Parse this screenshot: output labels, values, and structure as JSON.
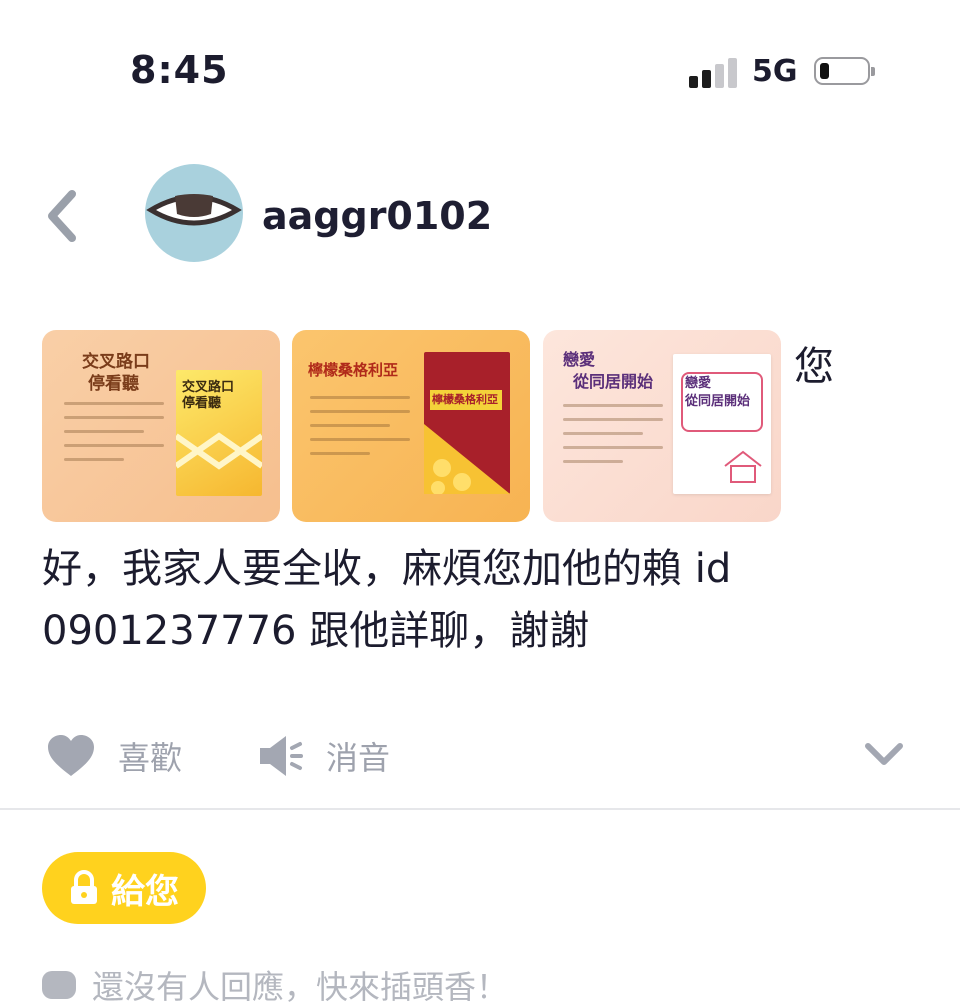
{
  "status_bar": {
    "time": "8:45",
    "network": "5G"
  },
  "header": {
    "username": "aaggr0102"
  },
  "post": {
    "images": [
      {
        "title_a": "交叉路口",
        "title_b": "停看聽",
        "cover_a": "交叉路口",
        "cover_b": "停看聽"
      },
      {
        "title_a": "檸檬桑格利亞",
        "title_b": "",
        "cover_a": "檸檬桑格利亞",
        "cover_b": ""
      },
      {
        "title_a": "戀愛",
        "title_b": "從同居開始",
        "cover_a": "戀愛",
        "cover_b": "從同居開始"
      }
    ],
    "text_first": "您",
    "text_rest": "好，我家人要全收，麻煩您加他的賴 id 0901237776 跟他詳聊，謝謝"
  },
  "actions": {
    "like_label": "喜歡",
    "mute_label": "消音"
  },
  "give_button": {
    "label": "給您"
  },
  "replies": {
    "empty_text": "還沒有人回應，快來插頭香！"
  },
  "colors": {
    "accent_yellow": "#ffd21e",
    "avatar_bg": "#a9d1dd",
    "muted": "#9ea2ad"
  }
}
